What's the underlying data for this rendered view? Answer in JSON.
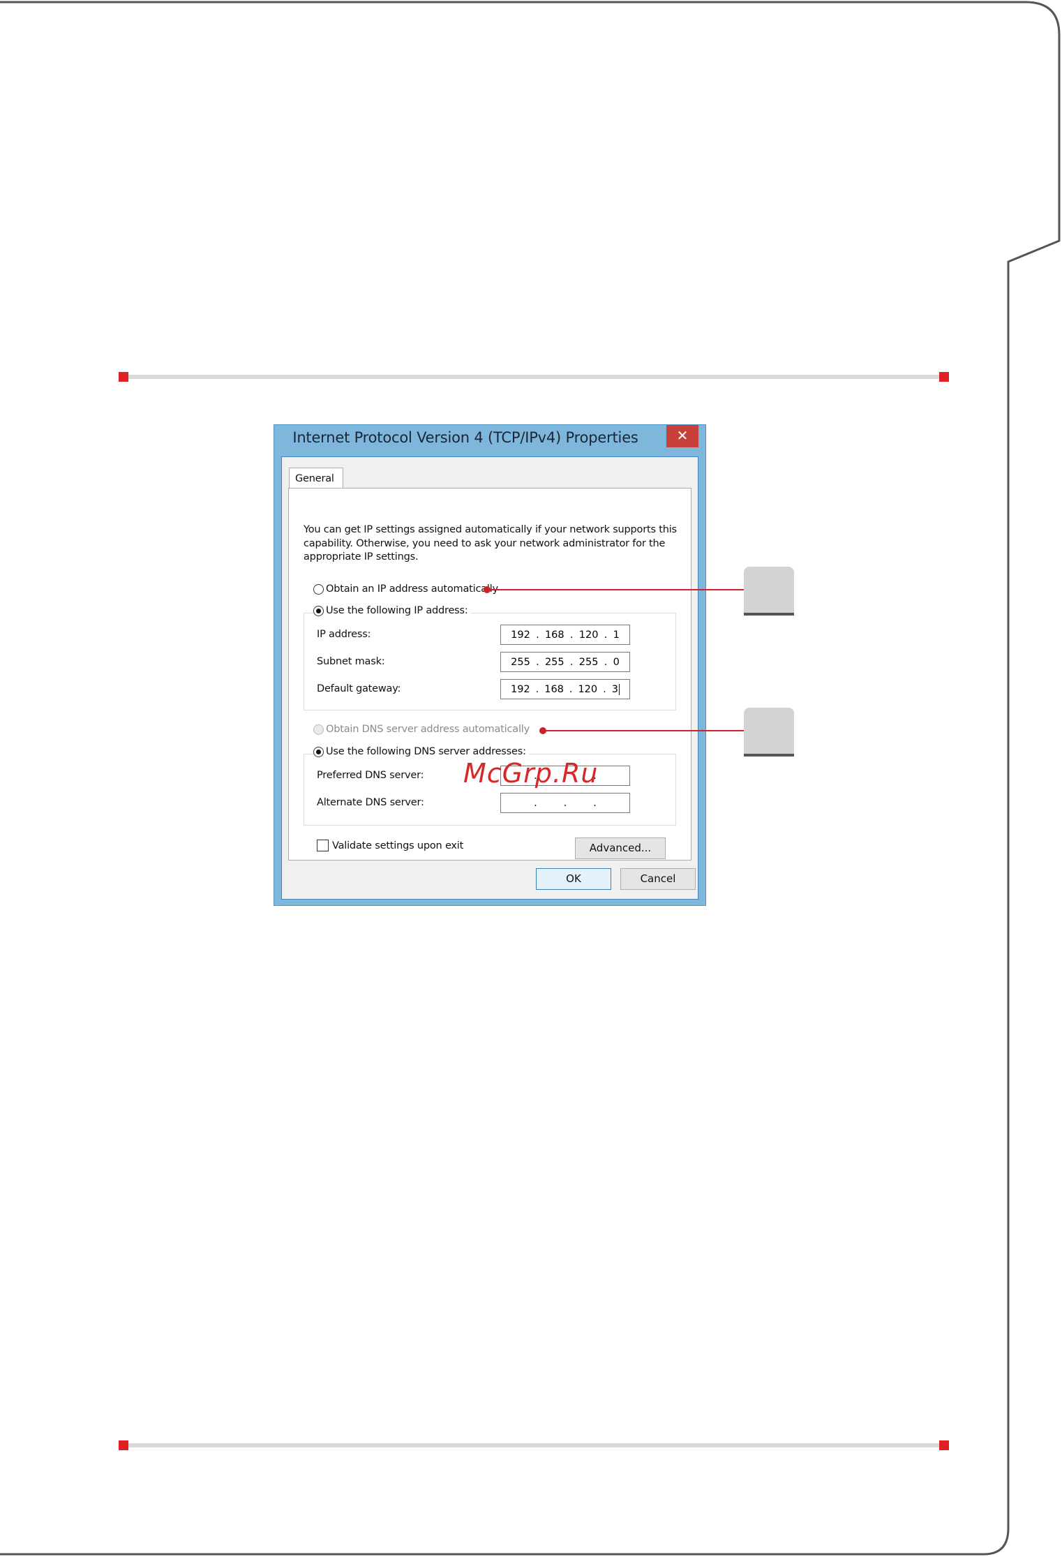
{
  "dialog": {
    "title": "Internet Protocol Version 4 (TCP/IPv4) Properties",
    "close_label": "✕",
    "tab_label": "General",
    "description": "You can get IP settings assigned automatically if your network supports this capability. Otherwise, you need to ask your network administrator for the appropriate IP settings.",
    "ip_auto_label": "Obtain an IP address automatically",
    "ip_manual_label": "Use the following IP address:",
    "ip_fields": [
      {
        "label": "IP address:",
        "octets": [
          "192",
          "168",
          "120",
          "1"
        ]
      },
      {
        "label": "Subnet mask:",
        "octets": [
          "255",
          "255",
          "255",
          "0"
        ]
      },
      {
        "label": "Default gateway:",
        "octets": [
          "192",
          "168",
          "120",
          "3"
        ]
      }
    ],
    "dns_auto_label": "Obtain DNS server address automatically",
    "dns_manual_label": "Use the following DNS server addresses:",
    "dns_fields": [
      {
        "label": "Preferred DNS server:"
      },
      {
        "label": "Alternate DNS server:"
      }
    ],
    "validate_label": "Validate settings upon exit",
    "advanced_label": "Advanced...",
    "ok_label": "OK",
    "cancel_label": "Cancel"
  },
  "watermark": "McGrp.Ru",
  "colors": {
    "accent_red": "#e02025",
    "title_bar_blue": "#7fb7dc",
    "close_red": "#c7413a"
  }
}
